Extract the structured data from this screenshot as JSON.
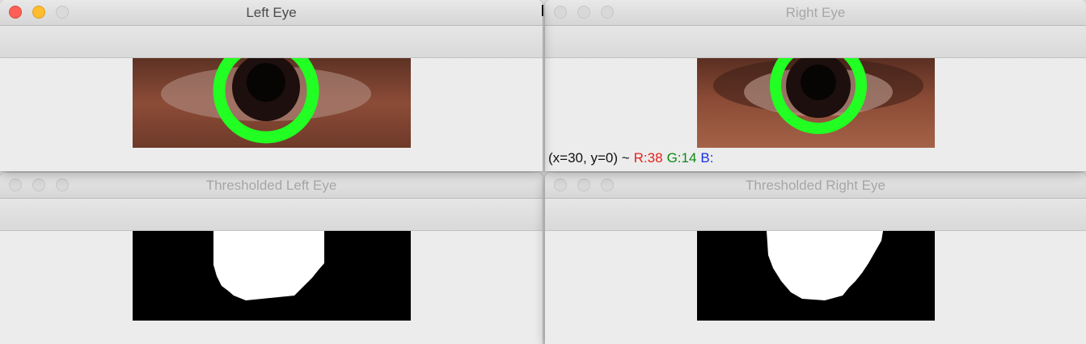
{
  "windows": {
    "left_eye": {
      "title": "Left Eye"
    },
    "right_eye": {
      "title": "Right Eye",
      "status": {
        "coords": "(x=30, y=0) ~",
        "r": "R:38",
        "g": "G:14",
        "b": "B:"
      }
    },
    "thresh_left": {
      "title": "Thresholded Left Eye"
    },
    "thresh_right": {
      "title": "Thresholded Right Eye"
    }
  },
  "icons": [
    "close-button",
    "minimize-button",
    "zoom-button"
  ],
  "colors": {
    "close": "#fd5f57",
    "minimize": "#febc2e",
    "pupil_circle": "#22ff22",
    "status_r": "#e8201b",
    "status_g": "#0f8a16",
    "status_b": "#1a2fe0"
  }
}
